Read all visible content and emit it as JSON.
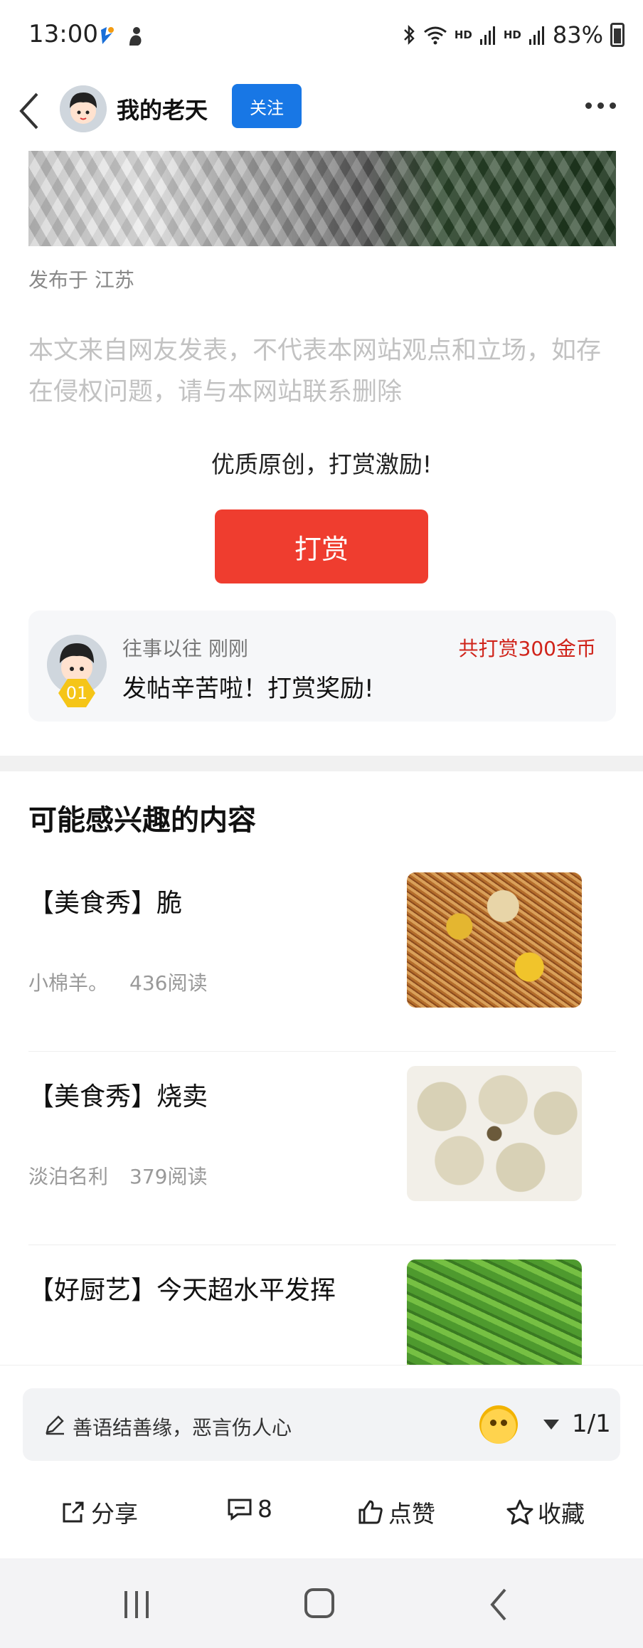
{
  "status_bar": {
    "time": "13:00",
    "hd1": "HD",
    "hd2": "HD",
    "battery": "83%"
  },
  "header": {
    "author": "我的老天",
    "follow_label": "关注"
  },
  "article": {
    "publish_location": "发布于 江苏",
    "disclaimer": "本文来自网友发表，不代表本网站观点和立场，如存在侵权问题，请与本网站联系删除"
  },
  "reward": {
    "prompt": "优质原创，打赏激励!",
    "button_label": "打赏",
    "card": {
      "rank": "01",
      "user_time": "往事以往 刚刚",
      "total": "共打赏300金币",
      "message": "发帖辛苦啦！打赏奖励!"
    }
  },
  "recommendations": {
    "title": "可能感兴趣的内容",
    "items": [
      {
        "title": "【美食秀】脆",
        "author": "小棉羊。",
        "reads": "436阅读",
        "thumb": "noodles"
      },
      {
        "title": "【美食秀】烧卖",
        "author": "淡泊名利",
        "reads": "379阅读",
        "thumb": "shaomai"
      },
      {
        "title": "【好厨艺】今天超水平发挥",
        "author": "",
        "reads": "",
        "thumb": "peas"
      }
    ]
  },
  "bottom_bar": {
    "comment_placeholder": "善语结善缘，恶言伤人心",
    "page_indicator": "1/1",
    "actions": {
      "share": "分享",
      "comments": "8",
      "like": "点赞",
      "favorite": "收藏"
    }
  }
}
